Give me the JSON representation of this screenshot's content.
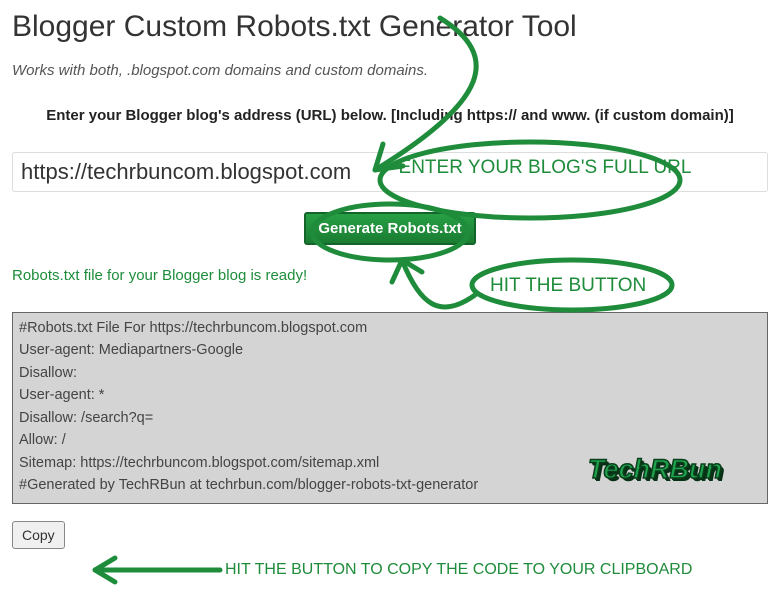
{
  "title": "Blogger Custom Robots.txt Generator Tool",
  "subtitle": "Works with both, .blogspot.com domains and custom domains.",
  "instruction": "Enter your Blogger blog's address (URL) below. [Including https:// and www. (if custom domain)]",
  "url_value": "https://techrbuncom.blogspot.com",
  "generate_label": "Generate Robots.txt",
  "ready_message": "Robots.txt file for your Blogger blog is ready!",
  "output_text": "#Robots.txt File For https://techrbuncom.blogspot.com\nUser-agent: Mediapartners-Google\nDisallow:\nUser-agent: *\nDisallow: /search?q=\nAllow: /\nSitemap: https://techrbuncom.blogspot.com/sitemap.xml\n#Generated by TechRBun at techrbun.com/blogger-robots-txt-generator",
  "copy_label": "Copy",
  "annotations": {
    "enter_url": "ENTER YOUR BLOG'S FULL URL",
    "hit_button": "HIT THE BUTTON",
    "copy_hint": "HIT THE BUTTON TO COPY THE CODE TO YOUR CLIPBOARD"
  },
  "logo_text": "TechRBun",
  "colors": {
    "accent": "#1e8c3a"
  }
}
